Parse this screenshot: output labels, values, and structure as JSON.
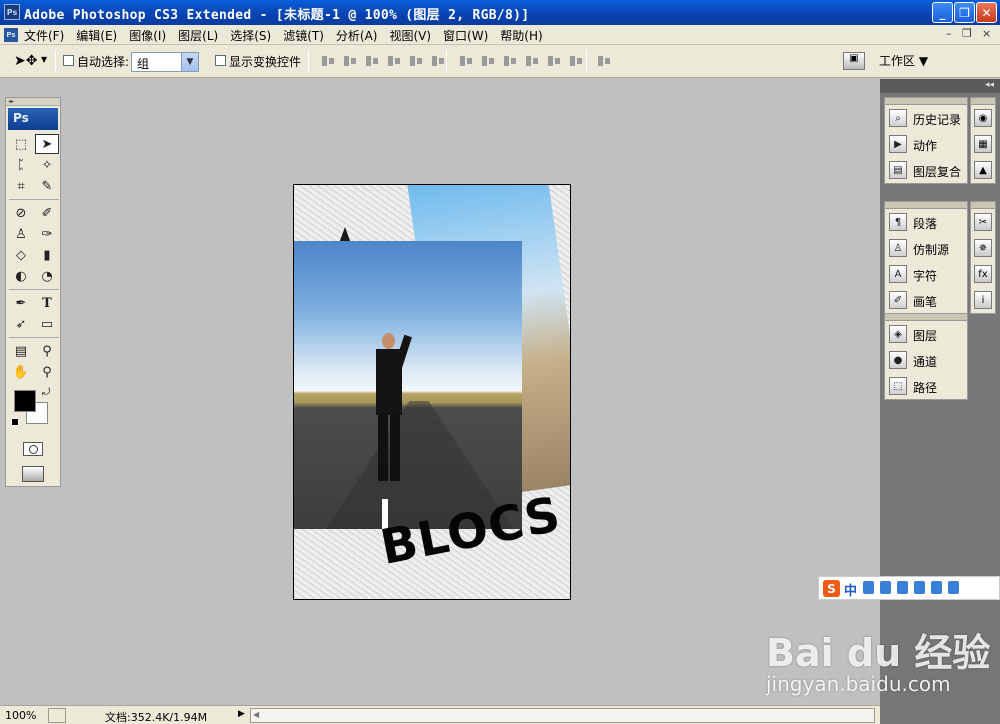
{
  "window": {
    "app_icon": "Ps",
    "title": "Adobe Photoshop CS3 Extended - [未标题-1 @ 100% (图层 2, RGB/8)]",
    "buttons": {
      "minimize": "_",
      "maximize": "❐",
      "close": "✕"
    }
  },
  "menubar": {
    "doc_icon": "Ps",
    "items": [
      "文件(F)",
      "编辑(E)",
      "图像(I)",
      "图层(L)",
      "选择(S)",
      "滤镜(T)",
      "分析(A)",
      "视图(V)",
      "窗口(W)",
      "帮助(H)"
    ],
    "doc_controls": {
      "minimize": "–",
      "restore": "❐",
      "close": "×"
    }
  },
  "options": {
    "auto_select_label": "自动选择:",
    "auto_select_checked": false,
    "auto_select_value": "组",
    "show_transform_label": "显示变换控件",
    "show_transform_checked": false,
    "workspace_label": "工作区 ▼"
  },
  "toolbox": {
    "logo": "Ps",
    "tools": [
      "marquee-tool",
      "move-tool",
      "lasso-tool",
      "magic-wand-tool",
      "crop-tool",
      "slice-tool",
      "healing-brush-tool",
      "brush-tool",
      "clone-stamp-tool",
      "history-brush-tool",
      "eraser-tool",
      "gradient-tool",
      "blur-tool",
      "dodge-tool",
      "pen-tool",
      "type-tool",
      "path-selection-tool",
      "shape-tool",
      "notes-tool",
      "eyedropper-tool",
      "hand-tool",
      "zoom-tool"
    ],
    "active_tool": "move-tool",
    "foreground_color": "#000000",
    "background_color": "#ffffff"
  },
  "document": {
    "text_layer": "BLOCS"
  },
  "statusbar": {
    "zoom": "100%",
    "doc_info": "文档:352.4K/1.94M",
    "arrow": "▶",
    "scroll_left": "◀"
  },
  "panels": {
    "group1": [
      "历史记录",
      "动作",
      "图层复合"
    ],
    "group2": [
      "段落",
      "仿制源",
      "字符",
      "画笔"
    ],
    "group3": [
      "图层",
      "通道",
      "路径"
    ]
  },
  "ime": {
    "logo": "S",
    "lang": "中"
  },
  "watermark": {
    "main": "Bai du 经验",
    "sub": "jingyan.baidu.com"
  },
  "colors": {
    "titlebar": "#0842b0",
    "chrome": "#ece9d8",
    "workspace": "#c0c0c0",
    "dock": "#777777"
  }
}
